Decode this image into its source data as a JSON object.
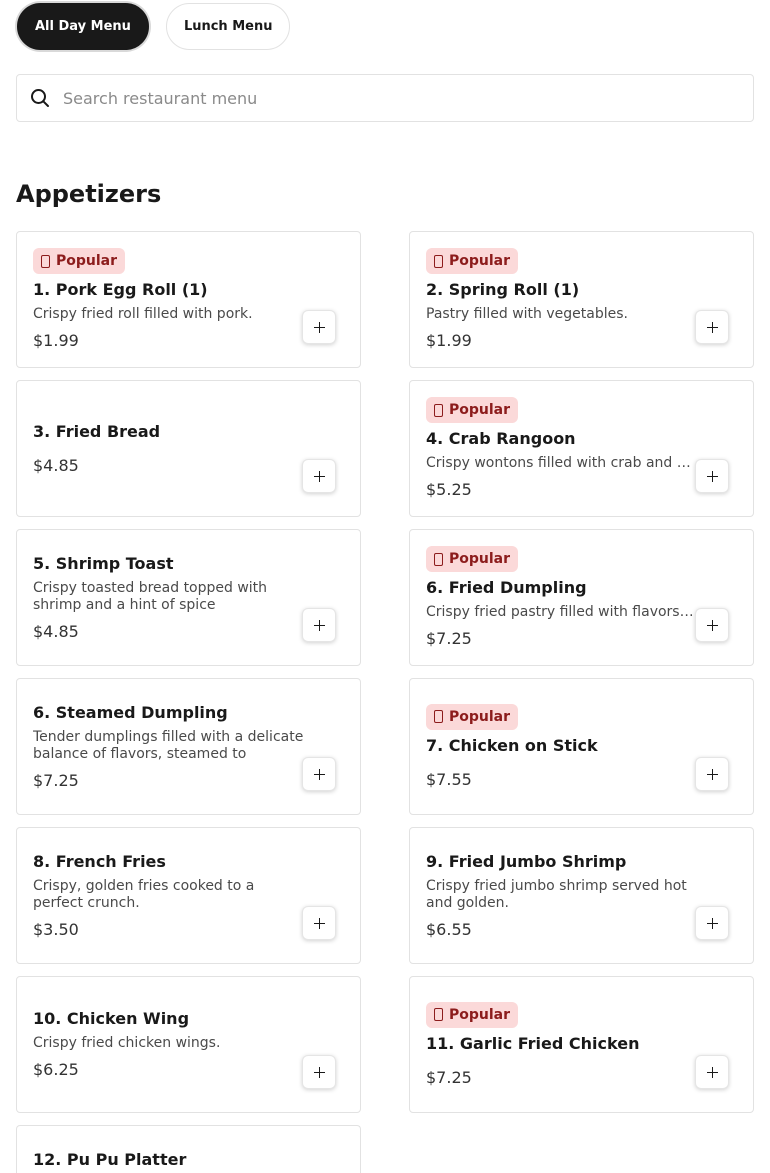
{
  "tabs": [
    {
      "label": "All Day Menu",
      "active": true
    },
    {
      "label": "Lunch Menu",
      "active": false
    }
  ],
  "search": {
    "placeholder": "Search restaurant menu",
    "icon": "search-icon"
  },
  "section": {
    "title": "Appetizers"
  },
  "badge_label": "Popular",
  "colors": {
    "badge_bg": "#fbd9d9",
    "badge_text": "#8c1c1c",
    "active_tab": "#191919"
  },
  "items": [
    {
      "name": "1. Pork Egg Roll (1)",
      "desc": "Crispy fried roll filled with pork.",
      "price": "$1.99",
      "popular": true
    },
    {
      "name": "2. Spring Roll (1)",
      "desc": "Pastry filled with vegetables.",
      "price": "$1.99",
      "popular": true
    },
    {
      "name": "3. Fried Bread",
      "desc": "",
      "price": "$4.85",
      "popular": false
    },
    {
      "name": "4. Crab Rangoon",
      "desc": "Crispy wontons filled with crab and cream cheese.",
      "price": "$5.25",
      "popular": true
    },
    {
      "name": "5. Shrimp Toast",
      "desc": "Crispy toasted bread topped with shrimp and a hint of spice",
      "price": "$4.85",
      "popular": false
    },
    {
      "name": "6. Fried Dumpling",
      "desc": "Crispy fried pastry filled with flavors, served hot.",
      "price": "$7.25",
      "popular": true
    },
    {
      "name": "6. Steamed Dumpling",
      "desc": "Tender dumplings filled with a delicate balance of flavors, steamed to perfection.",
      "price": "$7.25",
      "popular": false
    },
    {
      "name": "7. Chicken on Stick",
      "desc": "",
      "price": "$7.55",
      "popular": true
    },
    {
      "name": "8. French Fries",
      "desc": "Crispy, golden fries cooked to a perfect crunch.",
      "price": "$3.50",
      "popular": false
    },
    {
      "name": "9. Fried Jumbo Shrimp",
      "desc": "Crispy fried jumbo shrimp served hot and golden.",
      "price": "$6.55",
      "popular": false
    },
    {
      "name": "10. Chicken Wing",
      "desc": "Crispy fried chicken wings.",
      "price": "$6.25",
      "popular": false
    },
    {
      "name": "11. Garlic Fried Chicken",
      "desc": "",
      "price": "$7.25",
      "popular": true
    },
    {
      "name": "12. Pu Pu Platter",
      "desc": "",
      "price": "",
      "popular": false
    }
  ]
}
